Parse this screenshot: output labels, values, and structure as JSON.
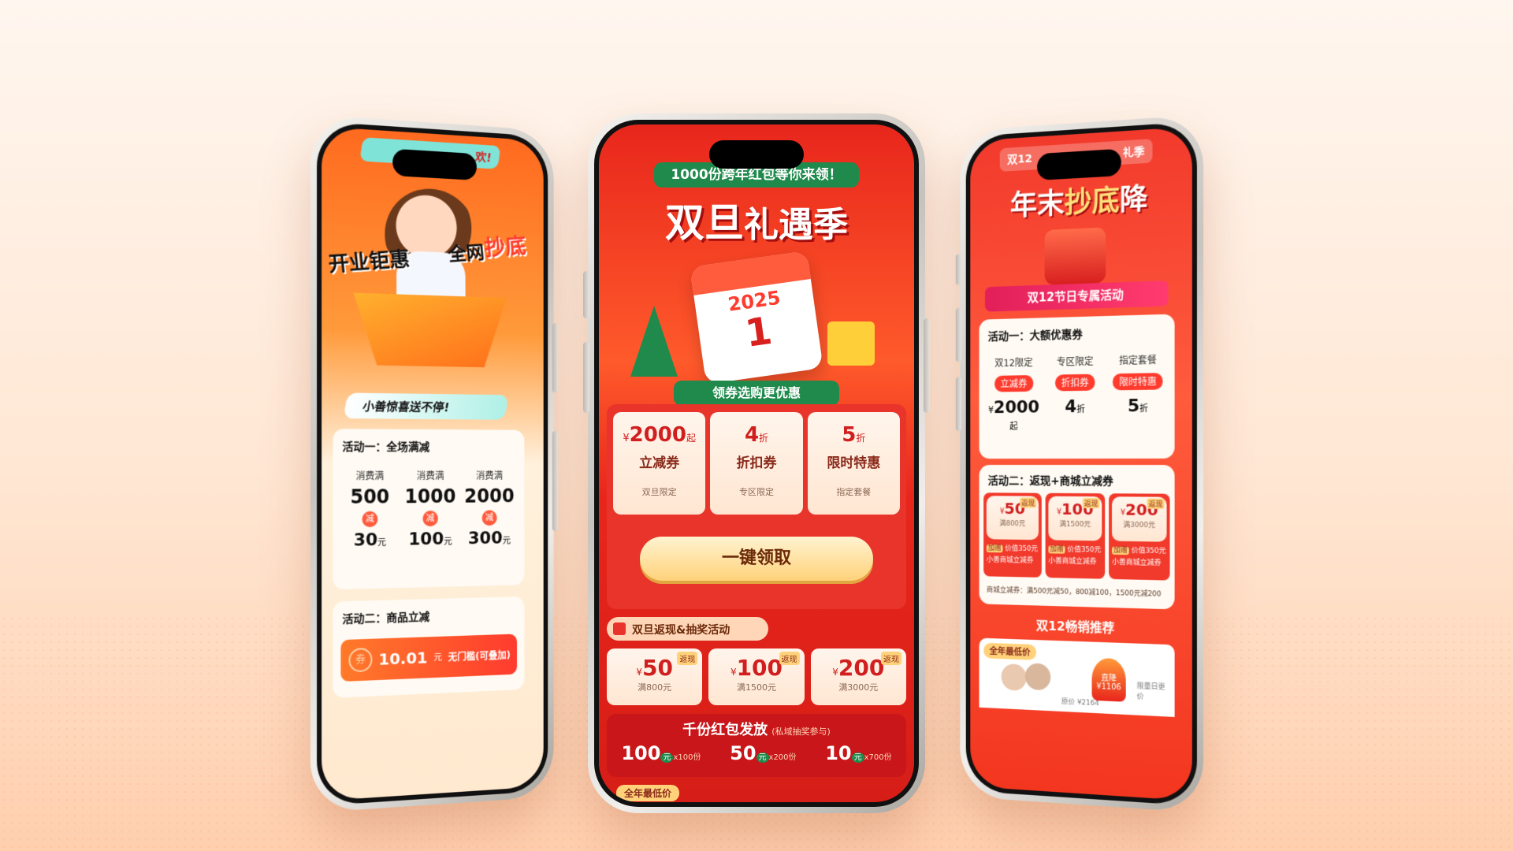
{
  "phone_left": {
    "top_ribbon": "欢!",
    "hero_left": "开业钜惠",
    "hero_right_a": "全网",
    "hero_right_b": "抄底",
    "banner": "小善惊喜送不停!",
    "act1_title": "活动一：全场满减",
    "tiers": [
      {
        "label": "消费满",
        "amount": "500",
        "cut_label": "减",
        "cut": "30",
        "unit": "元"
      },
      {
        "label": "消费满",
        "amount": "1000",
        "cut_label": "减",
        "cut": "100",
        "unit": "元"
      },
      {
        "label": "消费满",
        "amount": "2000",
        "cut_label": "减",
        "cut": "300",
        "unit": "元"
      }
    ],
    "act2_title": "活动二：商品立减",
    "coupon_badge": "券",
    "coupon_value": "10.01",
    "coupon_unit": "元",
    "coupon_note": "无门槛(可叠加)"
  },
  "phone_center": {
    "top_ribbon": "1000份跨年红包等你来领！",
    "title_a": "双旦",
    "title_b": "礼遇季",
    "calendar_year": "2025",
    "calendar_day": "1",
    "banner": "领券选购更优惠",
    "coupons": [
      {
        "prefix": "¥",
        "value": "2000",
        "suffix": "起",
        "type": "立减券",
        "scope": "双旦限定"
      },
      {
        "prefix": "",
        "value": "4",
        "suffix": "折",
        "type": "折扣券",
        "scope": "专区限定"
      },
      {
        "prefix": "",
        "value": "5",
        "suffix": "折",
        "type": "限时特惠",
        "scope": "指定套餐"
      }
    ],
    "claim_button": "一键领取",
    "section2_title": "双旦返现&抽奖活动",
    "cashback": [
      {
        "value": "50",
        "tag": "返现",
        "cond": "满800元"
      },
      {
        "value": "100",
        "tag": "返现",
        "cond": "满1500元"
      },
      {
        "value": "200",
        "tag": "返现",
        "cond": "满3000元"
      }
    ],
    "cashback_prefix": "¥",
    "redpack_title": "千份红包发放",
    "redpack_note": "(私域抽奖参与)",
    "redpacks": [
      {
        "value": "100",
        "unit": "元",
        "count": "x100份"
      },
      {
        "value": "50",
        "unit": "元",
        "count": "x200份"
      },
      {
        "value": "10",
        "unit": "元",
        "count": "x700份"
      }
    ],
    "bottom_tag": "全年最低价"
  },
  "phone_right": {
    "top_ribbon": "双12",
    "top_ribbon_tail": "礼季",
    "title_a": "年末",
    "title_b": "抄底",
    "title_c": "降",
    "banner": "双12节日专属活动",
    "act1_title": "活动一：大额优惠券",
    "coupons": [
      {
        "label": "双12限定",
        "pill": "立减券",
        "prefix": "¥",
        "value": "2000",
        "suffix": "起"
      },
      {
        "label": "专区限定",
        "pill": "折扣券",
        "prefix": "",
        "value": "4",
        "suffix": "折"
      },
      {
        "label": "指定套餐",
        "pill": "限时特惠",
        "prefix": "",
        "value": "5",
        "suffix": "折"
      }
    ],
    "act2_title": "活动二：返现+商城立减券",
    "cashback": [
      {
        "value": "50",
        "tag": "返现",
        "cond": "满800元",
        "bonus_tag": "加赠",
        "bonus": "价值350元",
        "bonus_note": "小善商城立减券"
      },
      {
        "value": "100",
        "tag": "返现",
        "cond": "满1500元",
        "bonus_tag": "加赠",
        "bonus": "价值350元",
        "bonus_note": "小善商城立减券"
      },
      {
        "value": "200",
        "tag": "返现",
        "cond": "满3000元",
        "bonus_tag": "加赠",
        "bonus": "价值350元",
        "bonus_note": "小善商城立减券"
      }
    ],
    "cashback_prefix": "¥",
    "mall_note": "商城立减券：满500元减50，800减100，1500元减200",
    "recommend_title": "双12畅销推荐",
    "bottom_tag": "全年最低价",
    "flame_label": "直降",
    "flame_value": "¥1106",
    "price_label": "原价",
    "price_value": "¥2164",
    "side_note": "限量日更价"
  },
  "colors": {
    "brand_red": "#e8261c",
    "orange": "#ff7a2a",
    "green": "#1f8a4c",
    "cream": "#fff1dc"
  }
}
